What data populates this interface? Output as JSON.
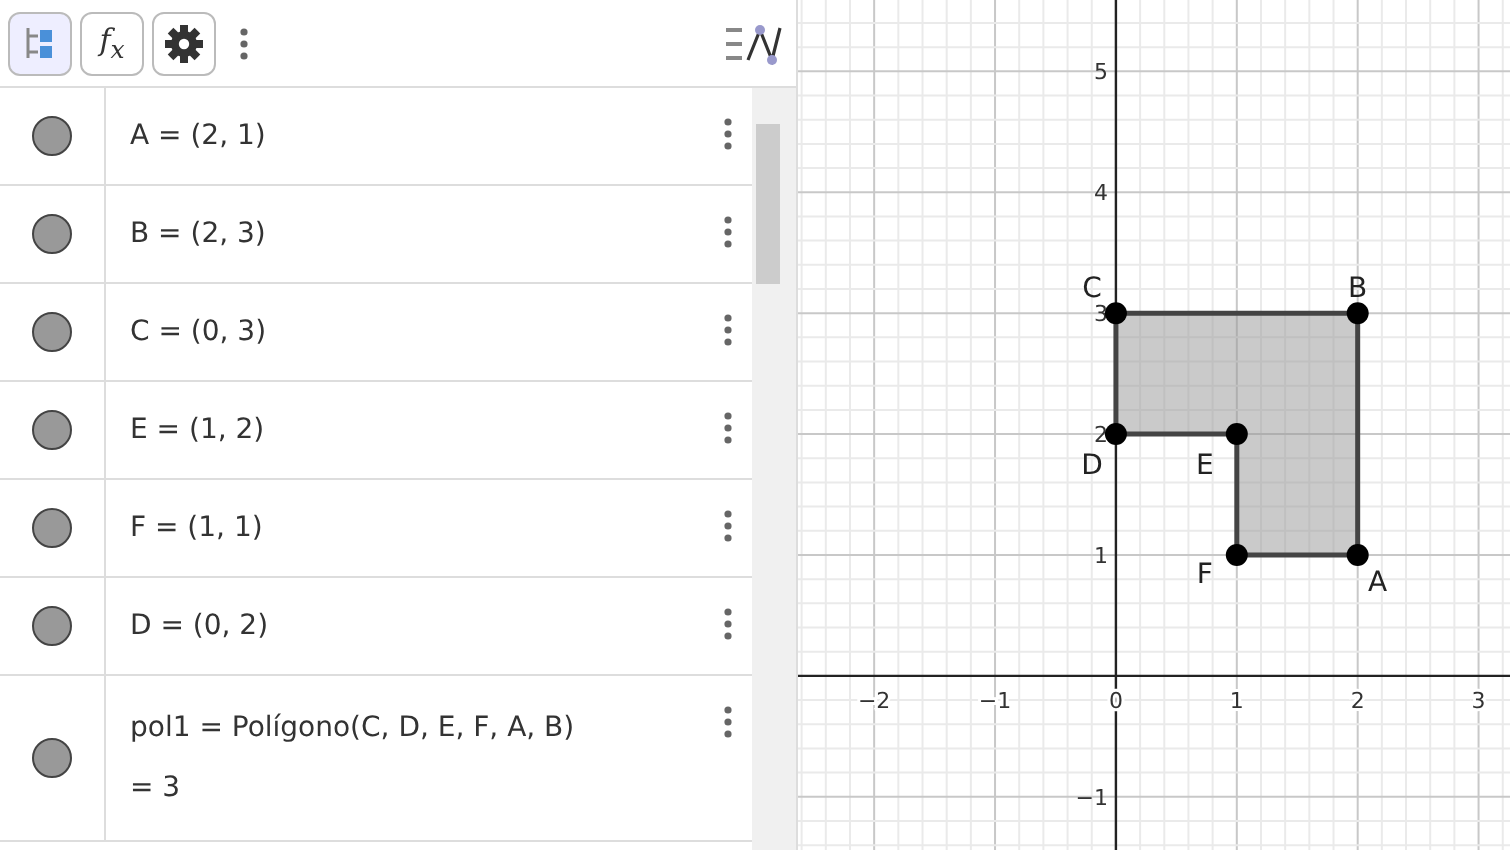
{
  "toolbar": {
    "buttons": [
      {
        "kind": "tree",
        "selected": true
      },
      {
        "kind": "function",
        "label": "f$_{x}$",
        "selected": false
      },
      {
        "kind": "settings",
        "selected": false
      }
    ]
  },
  "algebra": {
    "rows": [
      {
        "text": "A = (2, 1)",
        "visible": true
      },
      {
        "text": "B = (2, 3)",
        "visible": true
      },
      {
        "text": "C = (0, 3)",
        "visible": true
      },
      {
        "text": "E = (1, 2)",
        "visible": true
      },
      {
        "text": "F = (1, 1)",
        "visible": true
      },
      {
        "text": "D = (0, 2)",
        "visible": true
      },
      {
        "text": "pol1 = Polígono(C, D, E, F, A, B)",
        "result": "= 3",
        "visible": true
      }
    ]
  },
  "graphics": {
    "chart_data": {
      "type": "scatter",
      "x": [
        0,
        0,
        1,
        1,
        2,
        2
      ],
      "series": [
        {
          "color": "#000000",
          "values": [
            3,
            2,
            2,
            1,
            1,
            3
          ]
        }
      ],
      "grid": true,
      "xlim": [
        -2.63,
        3.26
      ],
      "ylim": [
        -1.44,
        5.59
      ],
      "xticks": [
        {
          "value": -2,
          "label": "−2"
        },
        {
          "value": -1,
          "label": "−1"
        },
        0,
        1,
        2,
        3
      ],
      "yticks": [
        {
          "value": -1,
          "label": "−1"
        },
        1,
        2,
        3,
        4,
        5
      ],
      "annotations": [
        {
          "text": "C",
          "x": 0,
          "y": 3
        },
        {
          "text": "D",
          "x": 0,
          "y": 2
        },
        {
          "text": "E",
          "x": 1,
          "y": 2
        },
        {
          "text": "F",
          "x": 1,
          "y": 1
        },
        {
          "text": "A",
          "x": 2,
          "y": 1
        },
        {
          "text": "B",
          "x": 2,
          "y": 3
        }
      ]
    }
  }
}
